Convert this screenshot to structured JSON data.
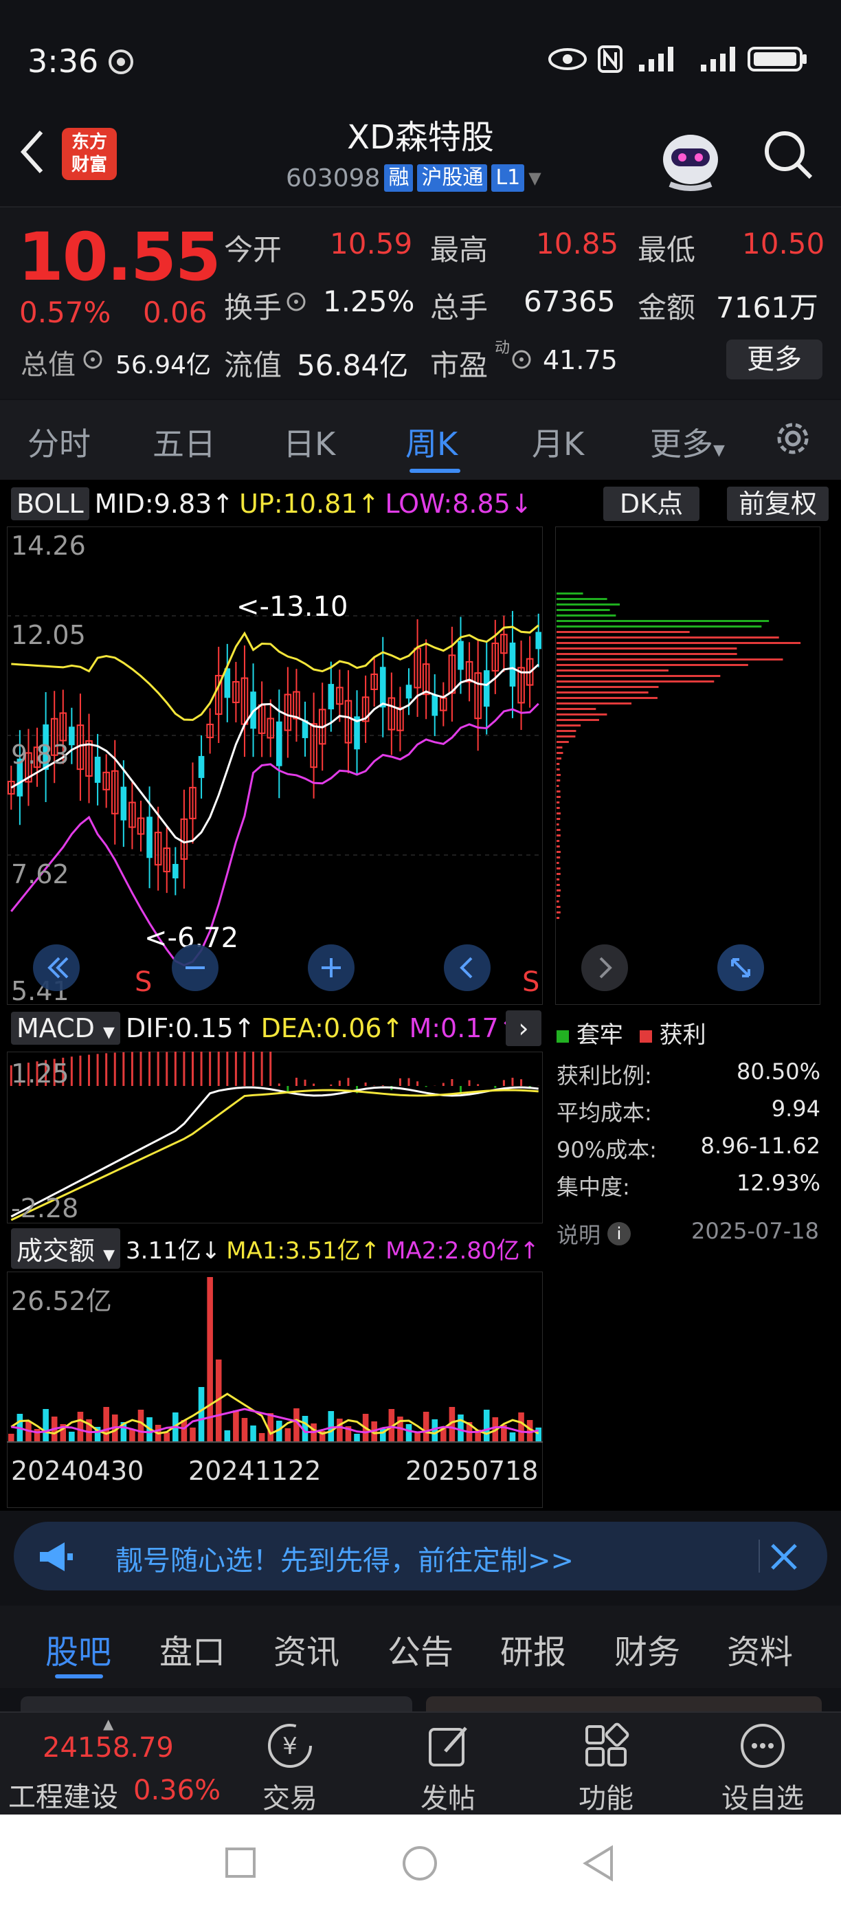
{
  "status": {
    "time": "3:36"
  },
  "header": {
    "brand": "东方财富",
    "title": "XD森特股",
    "code": "603098",
    "badges": [
      "融",
      "沪股通",
      "L1"
    ]
  },
  "quote": {
    "price": "10.55",
    "pct": "0.57%",
    "change": "0.06",
    "open_label": "今开",
    "open": "10.59",
    "high_label": "最高",
    "high": "10.85",
    "low_label": "最低",
    "low": "10.50",
    "turnover_label": "换手",
    "turnover": "1.25%",
    "volume_label": "总手",
    "volume": "67365",
    "amount_label": "金额",
    "amount": "7161万",
    "mktcap_label": "总值",
    "mktcap": "56.94亿",
    "float_label": "流值",
    "float": "56.84亿",
    "pe_label": "市盈",
    "pe_sup": "动",
    "pe": "41.75",
    "more": "更多"
  },
  "tabs": [
    "分时",
    "五日",
    "日K",
    "周K",
    "月K",
    "更多"
  ],
  "boll": {
    "name": "BOLL",
    "mid": "MID:9.83",
    "up": "UP:10.81",
    "low": "LOW:8.85",
    "dk": "DK点",
    "adj": "前复权",
    "y_ticks": [
      "14.26",
      "12.05",
      "9.83",
      "7.62",
      "5.41"
    ],
    "peak": "<-13.10",
    "trough": "<-6.72",
    "signal_left": "S",
    "signal_right": "S"
  },
  "macd": {
    "name": "MACD",
    "dif": "DIF:0.15",
    "dea": "DEA:0.06",
    "m": "M:0.17",
    "y_top": "1.25",
    "y_bottom": "-2.28"
  },
  "volume": {
    "name": "成交额",
    "value": "3.11亿",
    "ma1": "MA1:3.51亿",
    "ma2": "MA2:2.80亿",
    "y_top": "26.52亿",
    "dates": [
      "20240430",
      "20241122",
      "20250718"
    ]
  },
  "chips": {
    "legend_trapped": "套牢",
    "legend_profit": "获利",
    "rows": [
      {
        "label": "获利比例:",
        "value": "80.50%"
      },
      {
        "label": "平均成本:",
        "value": "9.94"
      },
      {
        "label": "90%成本:",
        "value": "8.96-11.62"
      },
      {
        "label": "集中度:",
        "value": "12.93%"
      }
    ],
    "note_label": "说明",
    "date": "2025-07-18"
  },
  "ad": {
    "text": "靓号随心选！先到先得，前往定制>>"
  },
  "subtabs": [
    "股吧",
    "盘口",
    "资讯",
    "公告",
    "研报",
    "财务",
    "资料"
  ],
  "bottom": {
    "index_value": "24158.79",
    "index_name": "工程建设",
    "index_pct": "0.36%",
    "nav": [
      "交易",
      "发帖",
      "功能",
      "设自选"
    ]
  }
}
